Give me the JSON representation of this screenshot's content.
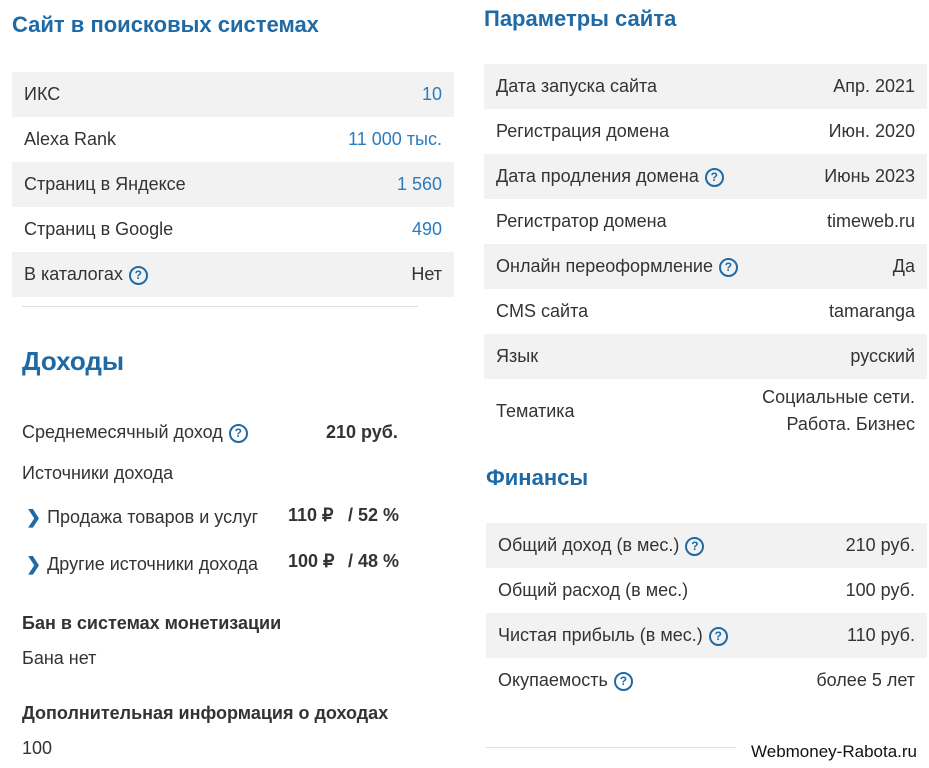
{
  "search": {
    "title": "Сайт в поисковых системах",
    "rows": [
      {
        "label": "ИКС",
        "value": "10"
      },
      {
        "label": "Alexa Rank",
        "value": "11 000 тыс."
      },
      {
        "label": "Страниц в Яндексе",
        "value": "1 560"
      },
      {
        "label": "Страниц в Google",
        "value": "490"
      },
      {
        "label": "В каталогах",
        "value": "Нет"
      }
    ]
  },
  "income": {
    "title": "Доходы",
    "avg_label": "Среднемесячный доход",
    "avg_value": "210 руб.",
    "sources_label": "Источники дохода",
    "sources": [
      {
        "label": "Продажа товаров и услуг",
        "amount": "110 ₽",
        "percent": "/ 52 %"
      },
      {
        "label": "Другие источники дохода",
        "amount": "100 ₽",
        "percent": "/ 48 %"
      }
    ],
    "ban_title": "Бан в системах монетизации",
    "ban_value": "Бана нет",
    "extra_title": "Дополнительная информация о доходах",
    "extra_value": "100"
  },
  "params": {
    "title": "Параметры сайта",
    "rows": [
      {
        "label": "Дата запуска сайта",
        "value": "Апр. 2021"
      },
      {
        "label": "Регистрация домена",
        "value": "Июн. 2020"
      },
      {
        "label": "Дата продления домена",
        "value": "Июнь 2023"
      },
      {
        "label": "Регистратор домена",
        "value": "timeweb.ru"
      },
      {
        "label": "Онлайн переоформление",
        "value": "Да"
      },
      {
        "label": "CMS сайта",
        "value": "tamaranga"
      },
      {
        "label": "Язык",
        "value": "русский"
      },
      {
        "label": "Тематика",
        "value_line1": "Социальные сети.",
        "value_line2": "Работа. Бизнес"
      }
    ]
  },
  "finance": {
    "title": "Финансы",
    "rows": [
      {
        "label": "Общий доход (в мес.)",
        "value": "210 руб."
      },
      {
        "label": "Общий расход (в мес.)",
        "value": "100 руб."
      },
      {
        "label": "Чистая прибыль (в мес.)",
        "value": "110 руб."
      },
      {
        "label": "Окупаемость",
        "value": "более 5 лет"
      }
    ]
  },
  "watermark": "Webmoney-Rabota.ru",
  "help_symbol": "?"
}
